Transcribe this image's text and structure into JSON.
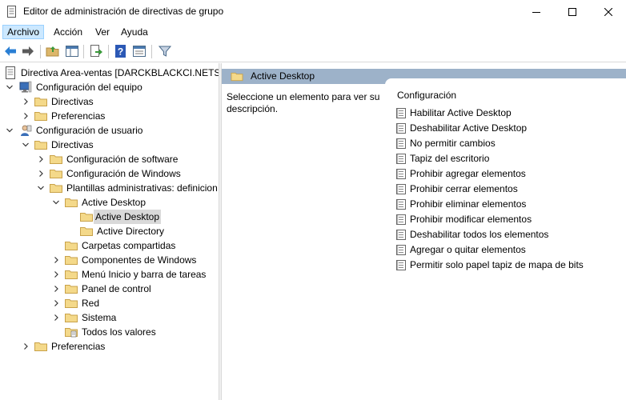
{
  "window": {
    "title": "Editor de administración de directivas de grupo"
  },
  "menubar": {
    "items": [
      {
        "label": "Archivo",
        "active": true
      },
      {
        "label": "Acción"
      },
      {
        "label": "Ver"
      },
      {
        "label": "Ayuda"
      }
    ]
  },
  "toolbar": {
    "buttons": [
      "back-icon",
      "forward-icon",
      "up-folder-icon",
      "show-hide-tree-icon",
      "export-list-icon",
      "help-icon",
      "properties-view-icon",
      "filter-icon"
    ]
  },
  "tree": {
    "root": "Directiva Area-ventas [DARCKBLACKCI.NETSEC",
    "computer_config": "Configuración del equipo",
    "c_policies": "Directivas",
    "c_preferences": "Preferencias",
    "user_config": "Configuración de usuario",
    "u_policies": "Directivas",
    "software": "Configuración de software",
    "windows": "Configuración de Windows",
    "admin_templates": "Plantillas administrativas: definicion",
    "active_desktop_parent": "Active Desktop",
    "active_desktop_child": "Active Desktop",
    "active_directory": "Active Directory",
    "shared_folders": "Carpetas compartidas",
    "windows_components": "Componentes de Windows",
    "start_menu": "Menú Inicio y barra de tareas",
    "control_panel": "Panel de control",
    "network": "Red",
    "system": "Sistema",
    "all_settings": "Todos los valores",
    "u_preferences": "Preferencias"
  },
  "details": {
    "header_title": "Active Desktop",
    "description": "Seleccione un elemento para ver su descripción.",
    "column_header": "Configuración",
    "settings": [
      "Habilitar Active Desktop",
      "Deshabilitar Active Desktop",
      "No permitir cambios",
      "Tapiz del escritorio",
      "Prohibir agregar elementos",
      "Prohibir cerrar elementos",
      "Prohibir eliminar elementos",
      "Prohibir modificar elementos",
      "Deshabilitar todos los elementos",
      "Agregar o quitar elementos",
      "Permitir solo papel tapiz de mapa de bits"
    ]
  },
  "colors": {
    "header_band": "#9db2c9",
    "selected_bg": "#d9d9d9",
    "folder": "#dcb66a",
    "menu_active": "#cce8ff"
  }
}
